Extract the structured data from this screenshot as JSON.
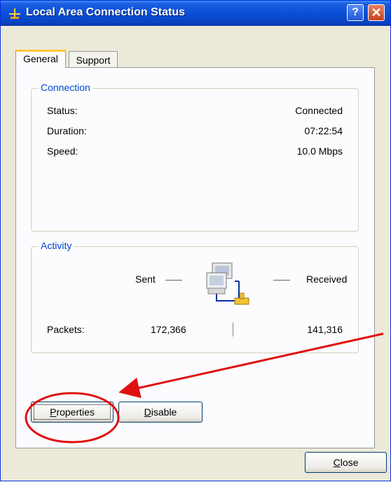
{
  "window": {
    "title": "Local Area Connection Status",
    "help_glyph": "?",
    "close_glyph": "✕"
  },
  "tabs": [
    {
      "label": "General",
      "active": true
    },
    {
      "label": "Support",
      "active": false
    }
  ],
  "connection": {
    "group_label": "Connection",
    "rows": [
      {
        "label": "Status:",
        "value": "Connected"
      },
      {
        "label": "Duration:",
        "value": "07:22:54"
      },
      {
        "label": "Speed:",
        "value": "10.0 Mbps"
      }
    ]
  },
  "activity": {
    "group_label": "Activity",
    "sent_label": "Sent",
    "received_label": "Received",
    "packets_label": "Packets:",
    "packets_sent": "172,366",
    "packets_received": "141,316"
  },
  "buttons": {
    "properties": {
      "first": "P",
      "rest": "roperties"
    },
    "disable": {
      "first": "D",
      "rest": "isable"
    },
    "close": {
      "first": "C",
      "rest": "lose"
    }
  },
  "colors": {
    "annotation": "#e01010",
    "group_label": "#0046d5",
    "title_bar": "#0a4fd6"
  },
  "icons": {
    "title": "network-connection-icon",
    "activity": "network-computers-icon"
  }
}
